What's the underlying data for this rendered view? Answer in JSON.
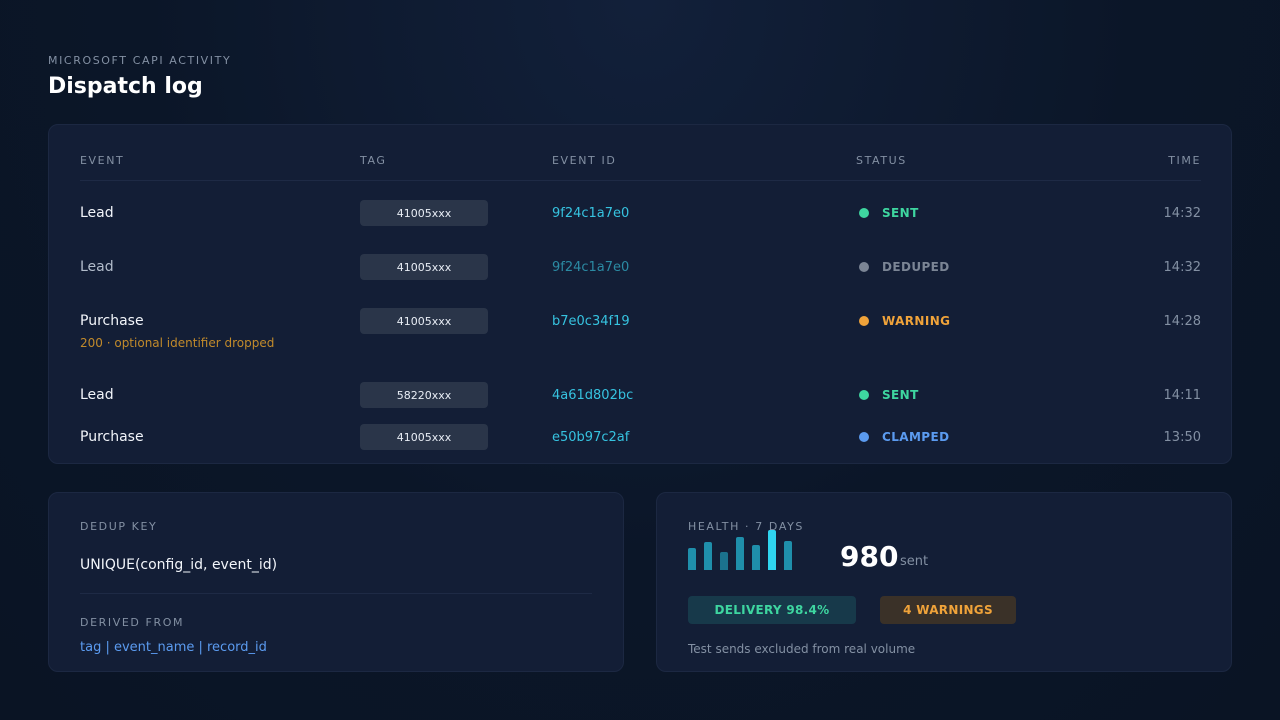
{
  "header": {
    "eyebrow": "MICROSOFT CAPI ACTIVITY",
    "title": "Dispatch log"
  },
  "log": {
    "columns": {
      "event": "EVENT",
      "tag": "TAG",
      "event_id": "EVENT ID",
      "status": "STATUS",
      "time": "TIME"
    },
    "rows": [
      {
        "event": "Lead",
        "tag": "41005xxx",
        "event_id": "9f24c1a7e0",
        "status": "SENT",
        "status_color": "#3ed6a0",
        "time": "14:32",
        "muted": false
      },
      {
        "event": "Lead",
        "tag": "41005xxx",
        "event_id": "9f24c1a7e0",
        "status": "DEDUPED",
        "status_color": "#7b8595",
        "time": "14:32",
        "muted": true
      },
      {
        "event": "Purchase",
        "tag": "41005xxx",
        "event_id": "b7e0c34f19",
        "status": "WARNING",
        "status_color": "#f0a33a",
        "time": "14:28",
        "muted": false,
        "note": "200 · optional identifier dropped"
      },
      {
        "event": "Lead",
        "tag": "58220xxx",
        "event_id": "4a61d802bc",
        "status": "SENT",
        "status_color": "#3ed6a0",
        "time": "14:11",
        "muted": false
      },
      {
        "event": "Purchase",
        "tag": "41005xxx",
        "event_id": "e50b97c2af",
        "status": "CLAMPED",
        "status_color": "#5b9bf0",
        "time": "13:50",
        "muted": false
      }
    ]
  },
  "dedup": {
    "label": "DEDUP KEY",
    "key": "UNIQUE(config_id, event_id)",
    "derived_label": "DERIVED FROM",
    "derived": "tag | event_name | record_id"
  },
  "health": {
    "label": "HEALTH · 7 DAYS",
    "daily_volume_relative": [
      0.55,
      0.7,
      0.45,
      0.82,
      0.62,
      1.0,
      0.72
    ],
    "highlight_index": 5,
    "bar_color": "#1f8fab",
    "highlight_color": "#2fd4ef",
    "sent_count": "980",
    "sent_unit": "sent",
    "delivery_pill": "DELIVERY 98.4%",
    "warnings_pill": "4 WARNINGS",
    "footnote": "Test sends excluded from real volume"
  }
}
